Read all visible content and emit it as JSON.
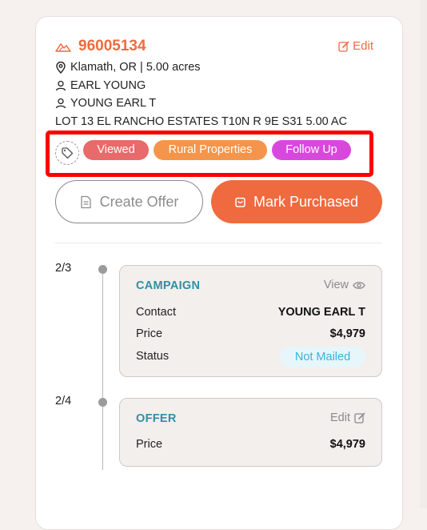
{
  "property": {
    "parcel_id": "96005134",
    "edit_label": "Edit",
    "location": "Klamath, OR | 5.00 acres",
    "owner_1": "EARL YOUNG",
    "owner_2": "YOUNG EARL T",
    "legal_description": "LOT 13 EL RANCHO ESTATES T10N R 9E S31 5.00 AC"
  },
  "tags": {
    "icon": "tag-icon",
    "items": [
      {
        "label": "Viewed",
        "color": "#e86a6a"
      },
      {
        "label": "Rural Properties",
        "color": "#f5954b"
      },
      {
        "label": "Follow Up",
        "color": "#d948dd"
      }
    ],
    "highlight_color": "#ff0000"
  },
  "actions": {
    "create_offer_label": "Create Offer",
    "mark_purchased_label": "Mark Purchased",
    "accent_color": "#ef6a3f"
  },
  "timeline": [
    {
      "date": "2/3",
      "title": "CAMPAIGN",
      "action_label": "View",
      "action_icon": "eye-icon",
      "rows": [
        {
          "label": "Contact",
          "value": "YOUNG EARL T"
        },
        {
          "label": "Price",
          "value": "$4,979"
        },
        {
          "label": "Status",
          "value": "Not Mailed"
        }
      ]
    },
    {
      "date": "2/4",
      "title": "OFFER",
      "action_label": "Edit",
      "action_icon": "edit-icon",
      "rows": [
        {
          "label": "Price",
          "value": "$4,979"
        }
      ]
    }
  ]
}
